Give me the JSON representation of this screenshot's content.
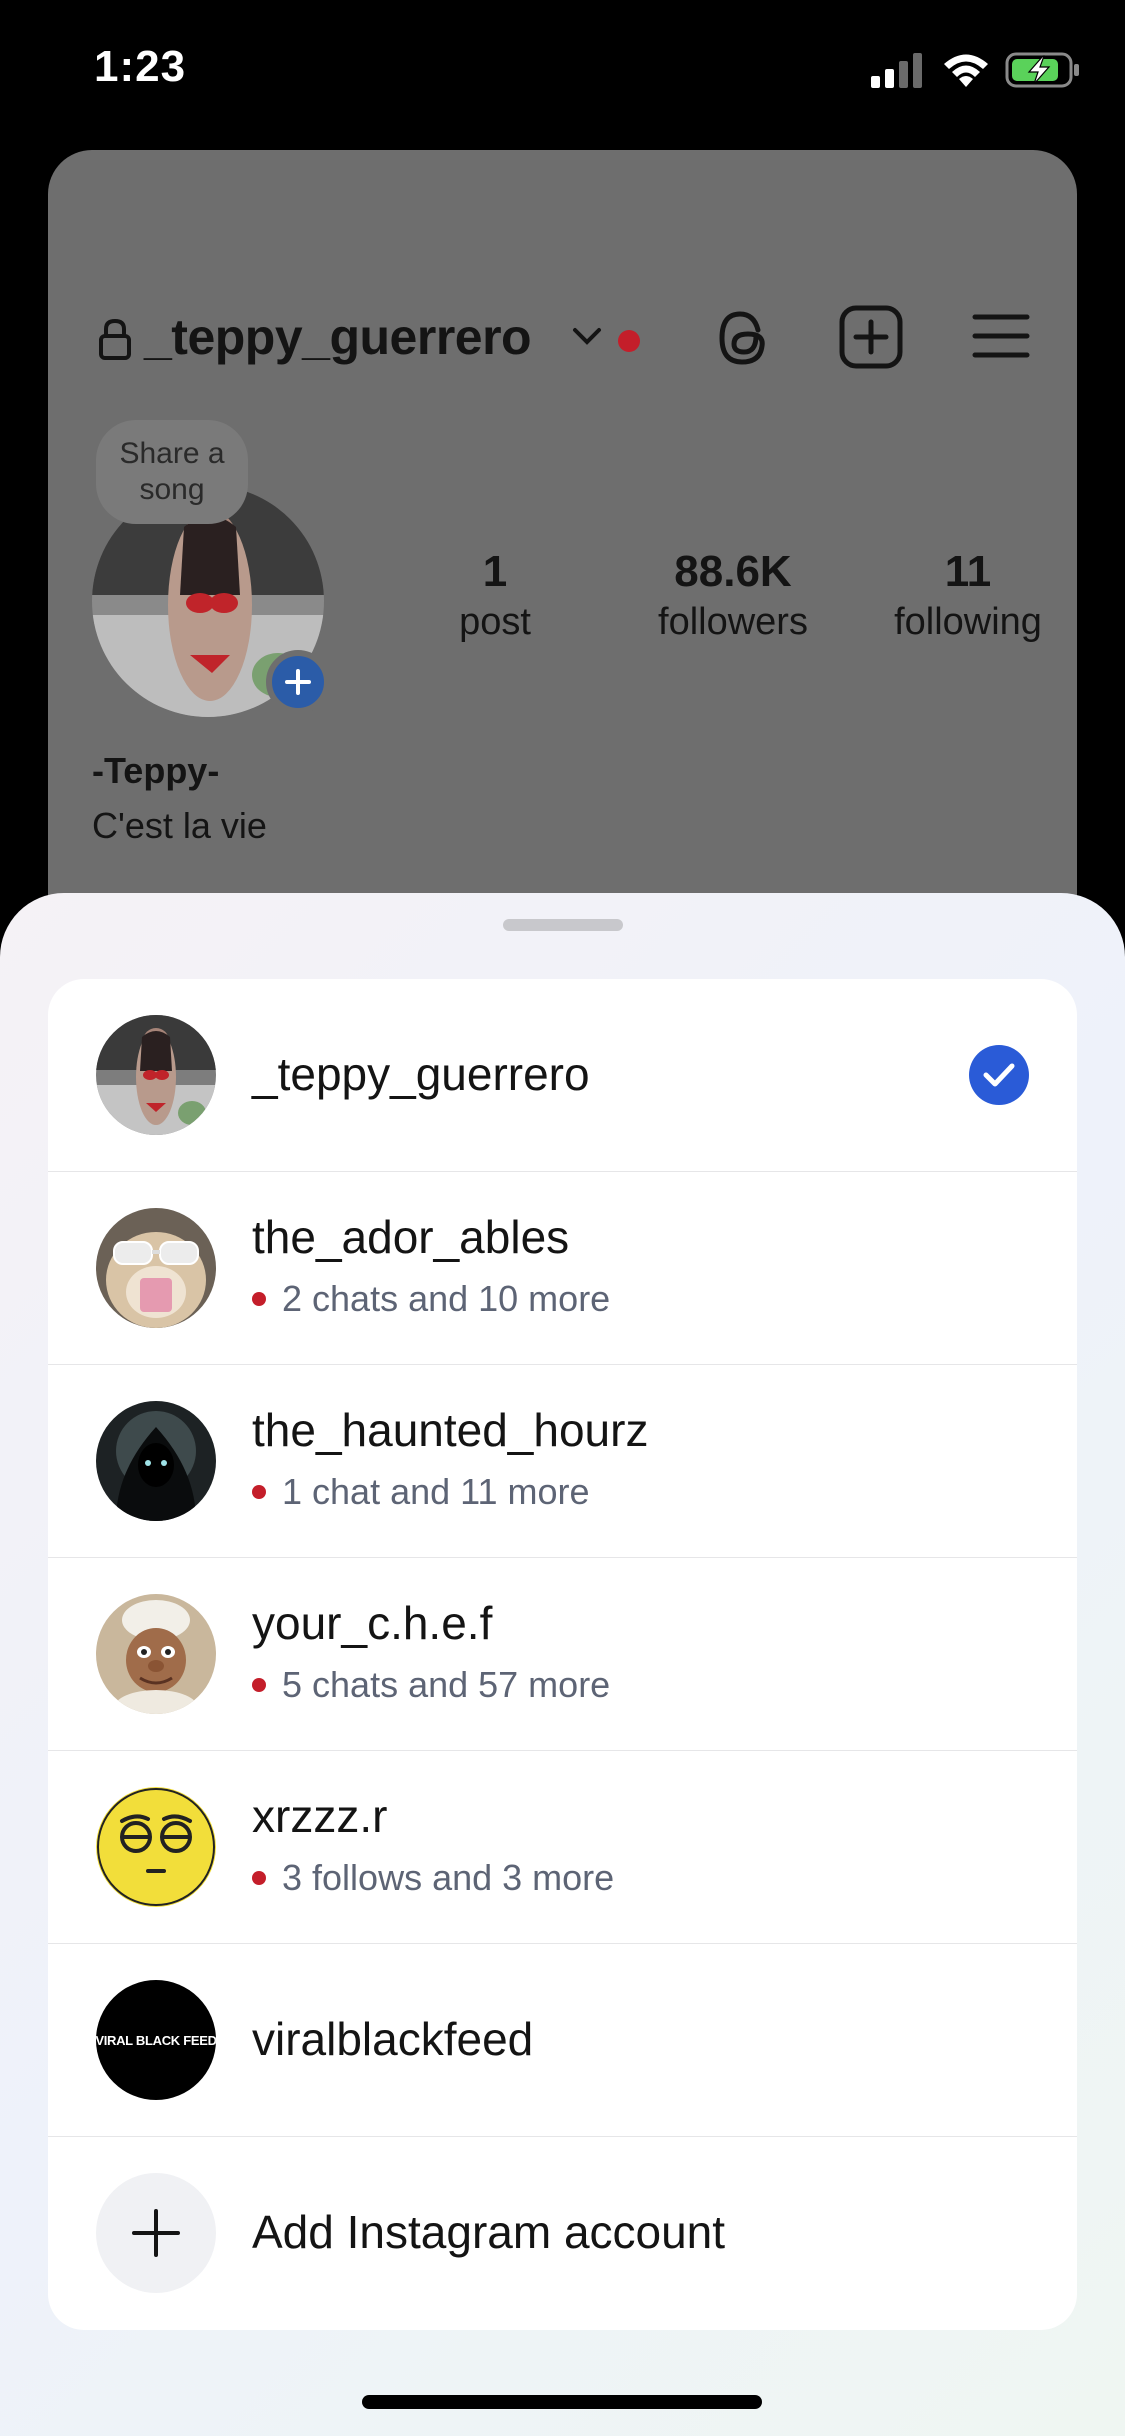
{
  "status_bar": {
    "time": "1:23",
    "signal_icon": "cellular-signal-icon",
    "wifi_icon": "wifi-icon",
    "battery_icon": "battery-charging-icon"
  },
  "profile": {
    "username": "_teppy_guerrero",
    "song_bubble": "Share a song",
    "stats": {
      "posts_value": "1",
      "posts_label": "post",
      "followers_value": "88.6K",
      "followers_label": "followers",
      "following_value": "11",
      "following_label": "following"
    },
    "display_name": "-Teppy-",
    "bio": "C'est la vie"
  },
  "account_switcher": {
    "accounts": [
      {
        "username": "_teppy_guerrero",
        "subtitle": "",
        "selected": true
      },
      {
        "username": "the_ador_ables",
        "subtitle": "2 chats and 10 more",
        "selected": false
      },
      {
        "username": "the_haunted_hourz",
        "subtitle": "1 chat and 11 more",
        "selected": false
      },
      {
        "username": "your_c.h.e.f",
        "subtitle": "5 chats and 57 more",
        "selected": false
      },
      {
        "username": "xrzzz.r",
        "subtitle": "3 follows and 3 more",
        "selected": false
      },
      {
        "username": "viralblackfeed",
        "subtitle": "",
        "selected": false,
        "avatar_text": "VIRAL BLACK FEED"
      }
    ],
    "add_account_label": "Add Instagram account"
  },
  "colors": {
    "accent_blue": "#2a5bd7",
    "notification_red": "#c41e2a"
  }
}
